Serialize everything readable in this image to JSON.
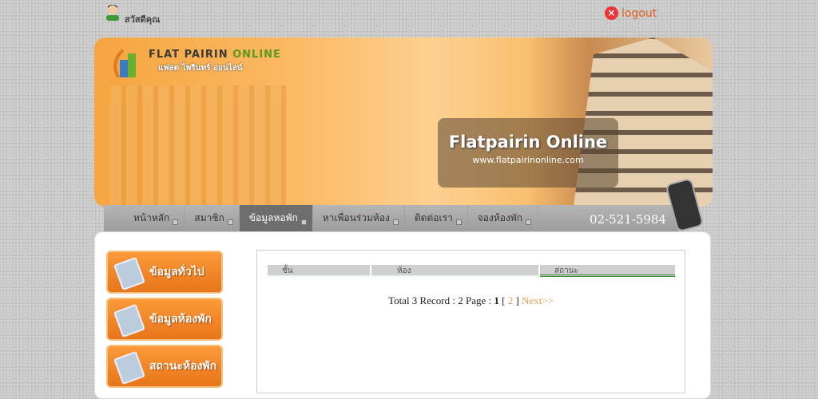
{
  "header": {
    "greeting": "สวัสดีคุณ",
    "logout_label": "logout"
  },
  "banner": {
    "logo_title": "FLAT  PAIRIN",
    "logo_title_accent": "ONLINE",
    "logo_subtitle": "แฟลต ไพรินทร์ ออนไลน์",
    "site_name": "Flatpairin Online",
    "site_url": "www.flatpairinonline.com"
  },
  "nav": {
    "items": [
      {
        "label": "หน้าหลัก"
      },
      {
        "label": "สมาชิก"
      },
      {
        "label": "ข้อมูลหอพัก"
      },
      {
        "label": "หาเพื่อนร่วมห้อง"
      },
      {
        "label": "ติดต่อเรา"
      },
      {
        "label": "จองห้องพัก"
      }
    ],
    "phone": "02-521-5984"
  },
  "sidebar": {
    "items": [
      {
        "label": "ข้อมูลทั่วไป"
      },
      {
        "label": "ข้อมูลห้องพัก"
      },
      {
        "label": "สถานะห้องพัก"
      }
    ]
  },
  "table": {
    "columns": [
      "ชั้น",
      "ห้อง",
      "สถานะ"
    ]
  },
  "pager": {
    "prefix": "Total 3 Record : 2 Page : ",
    "current": "1",
    "open": " [ ",
    "page2": "2",
    "close": " ] ",
    "next": "Next>>"
  }
}
